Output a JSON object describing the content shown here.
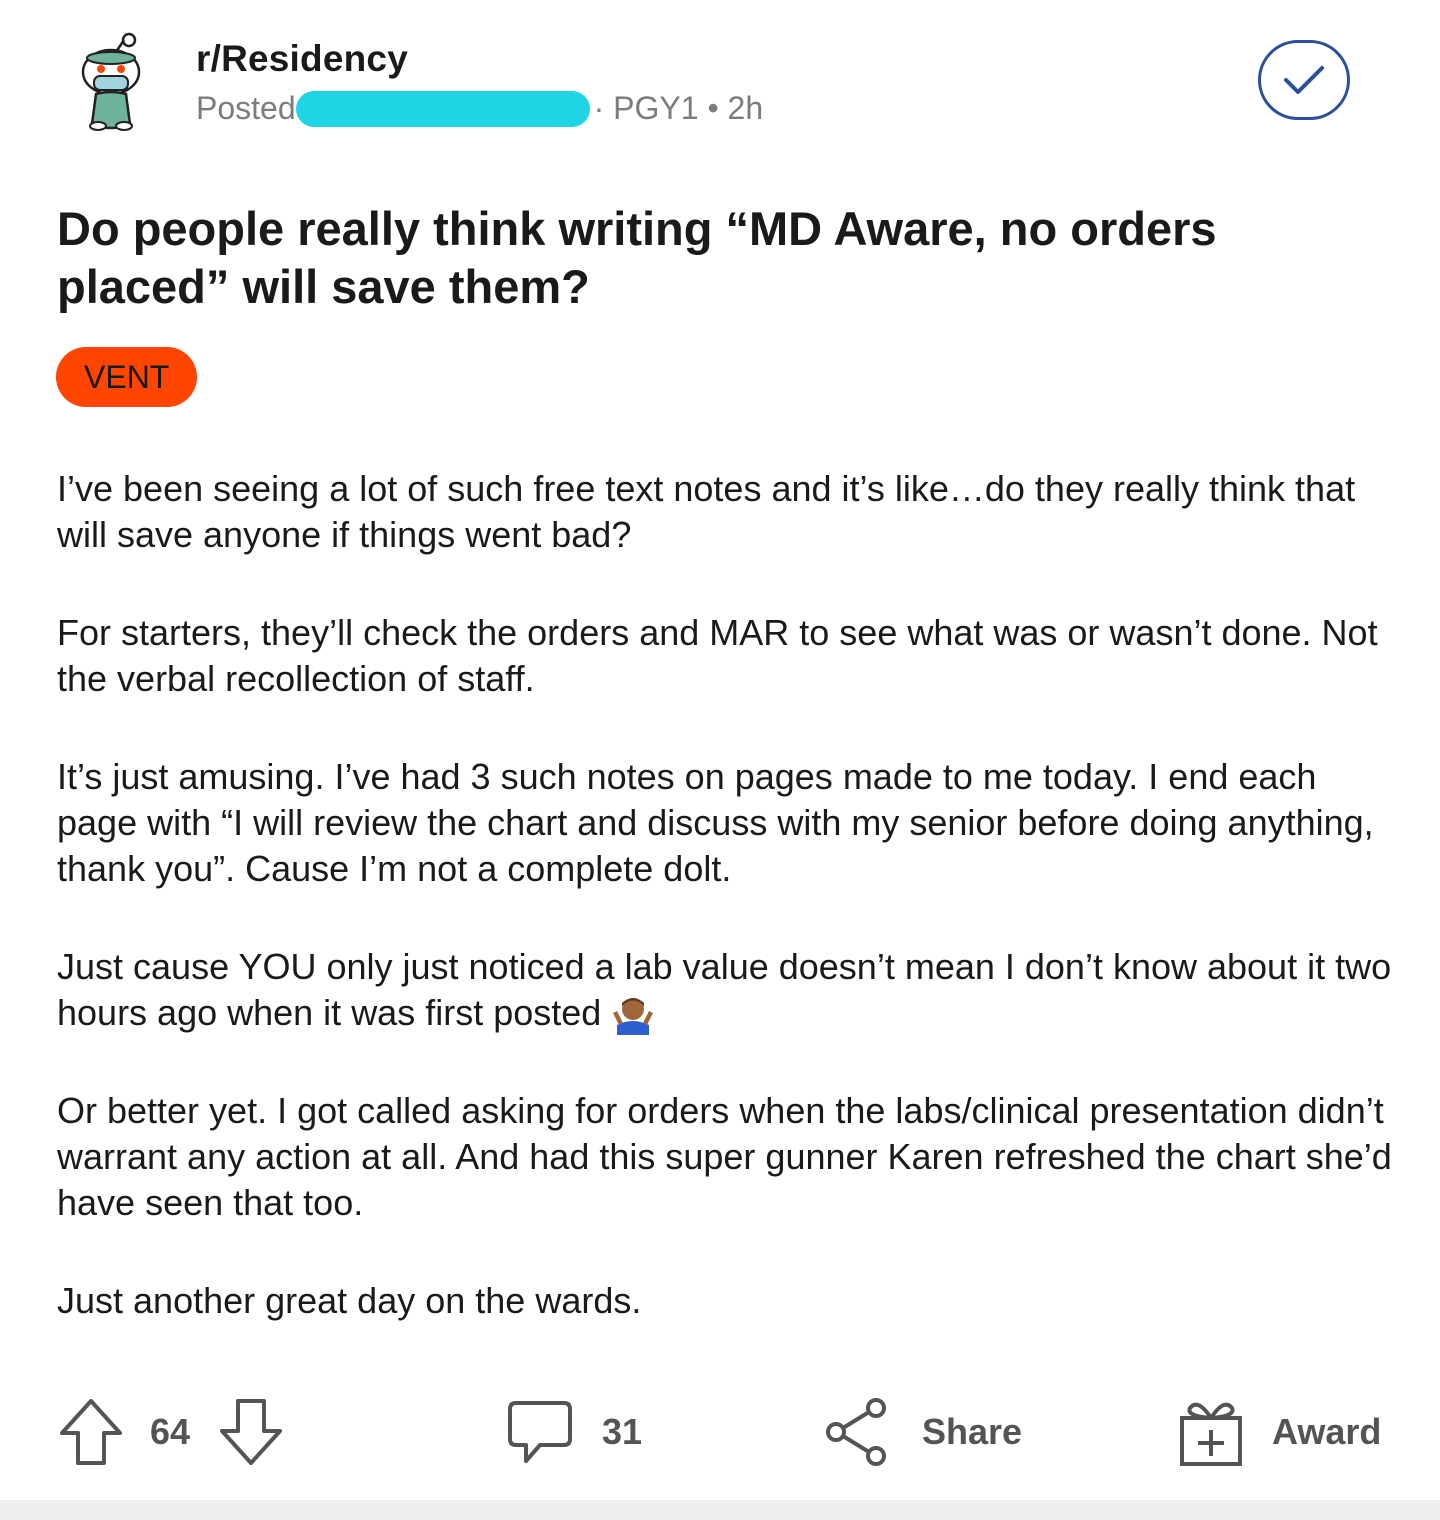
{
  "header": {
    "subreddit": "r/Residency",
    "meta_prefix": "Posted",
    "meta_suffix": "· PGY1 • 2h"
  },
  "post": {
    "title": "Do people really think writing “MD Aware, no orders placed” will save them?",
    "flair": "VENT",
    "paragraphs": [
      "I’ve been seeing a lot of such free text notes and it’s like…do they really think that will save anyone if things went bad?",
      "For starters, they’ll check the orders and MAR to see what was or wasn’t done. Not the verbal recollection of staff.",
      "It’s just amusing. I’ve had 3 such notes on pages made to me today. I end each page with “I will review the chart and discuss with my senior before doing anything, thank you”. Cause I’m not a complete dolt.",
      "Just cause YOU only just noticed a lab value doesn’t mean I don’t know about it two hours ago when it was first posted",
      "Or better yet. I got called asking for orders when the labs/clinical presentation didn’t warrant any action at all. And had this super gunner Karen refreshed the chart she’d have seen that too.",
      "Just another great day on the wards."
    ]
  },
  "actions": {
    "votes": "64",
    "comments": "31",
    "share_label": "Share",
    "award_label": "Award"
  },
  "colors": {
    "flair_bg": "#ff4500",
    "redaction": "#1fd5e3",
    "join_border": "#2a4f9c",
    "meta_text": "#7c7c7c"
  },
  "icons": [
    "snoo-doctor-avatar",
    "joined-check-icon",
    "upvote-icon",
    "downvote-icon",
    "comment-icon",
    "share-icon",
    "award-gift-icon",
    "shrug-emoji"
  ]
}
